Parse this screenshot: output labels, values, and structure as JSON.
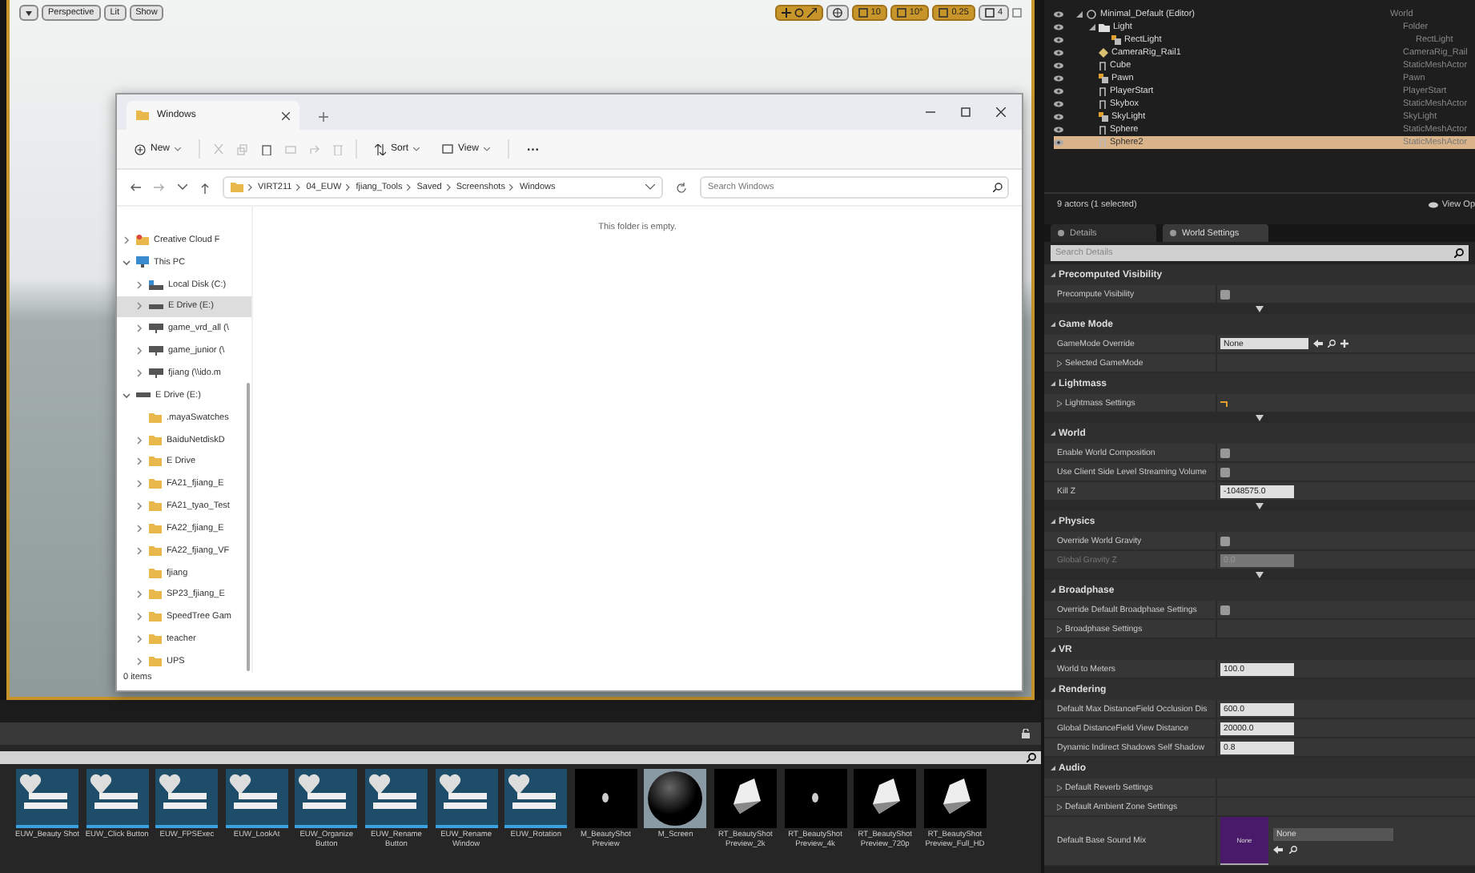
{
  "viewport": {
    "toolbar": {
      "left": [
        {
          "kind": "menu"
        },
        {
          "kind": "button",
          "label": "Perspective"
        },
        {
          "kind": "button",
          "label": "Lit"
        },
        {
          "kind": "button",
          "label": "Show"
        }
      ],
      "snap": [
        {
          "label": "10",
          "on": true
        },
        {
          "label": "10°",
          "on": true
        },
        {
          "label": "0.25",
          "on": true
        },
        {
          "label": "4",
          "on": false
        }
      ]
    }
  },
  "explorer": {
    "tab": "Windows",
    "toolbar": {
      "new": "New",
      "sort": "Sort",
      "view": "View",
      "more": "···"
    },
    "path": [
      "VIRT211",
      "04_EUW",
      "fjiang_Tools",
      "Saved",
      "Screenshots",
      "Windows"
    ],
    "search": {
      "placeholder": "Search Windows"
    },
    "empty_message": "This folder is empty.",
    "status": "0 items",
    "nav": [
      {
        "label": "Creative Cloud F",
        "kind": "cloud",
        "expanded": false,
        "selected": false
      },
      {
        "label": "This PC",
        "kind": "pc",
        "expanded": true,
        "selected": false,
        "children": [
          {
            "label": "Local Disk (C:)",
            "kind": "disk",
            "expanded": false,
            "selected": false
          },
          {
            "label": "E Drive (E:)",
            "kind": "drive",
            "expanded": false,
            "selected": true
          },
          {
            "label": "game_vrd_all (\\",
            "kind": "net",
            "expanded": false,
            "selected": false
          },
          {
            "label": "game_junior (\\",
            "kind": "net",
            "expanded": false,
            "selected": false
          },
          {
            "label": "fjiang (\\\\ido.m",
            "kind": "net",
            "expanded": false,
            "selected": false
          }
        ]
      },
      {
        "label": "E Drive (E:)",
        "kind": "drive",
        "expanded": true,
        "selected": false,
        "children": [
          {
            "label": ".mayaSwatches",
            "kind": "folder",
            "selected": false
          },
          {
            "label": "BaiduNetdiskD",
            "kind": "folder",
            "expanded": false,
            "selected": false
          },
          {
            "label": "E Drive",
            "kind": "folder",
            "expanded": false,
            "selected": false
          },
          {
            "label": "FA21_fjiang_E",
            "kind": "folder",
            "expanded": false,
            "selected": false
          },
          {
            "label": "FA21_tyao_Test",
            "kind": "folder",
            "expanded": false,
            "selected": false
          },
          {
            "label": "FA22_fjiang_E",
            "kind": "folder",
            "expanded": false,
            "selected": false
          },
          {
            "label": "FA22_fjiang_VF",
            "kind": "folder",
            "expanded": false,
            "selected": false
          },
          {
            "label": "fjiang",
            "kind": "folder",
            "selected": false
          },
          {
            "label": "SP23_fjiang_E",
            "kind": "folder",
            "expanded": false,
            "selected": false
          },
          {
            "label": "SpeedTree Gam",
            "kind": "folder",
            "expanded": false,
            "selected": false
          },
          {
            "label": "teacher",
            "kind": "folder",
            "expanded": false,
            "selected": false
          },
          {
            "label": "UPS",
            "kind": "folder",
            "expanded": false,
            "selected": false
          }
        ]
      }
    ]
  },
  "content_browser": {
    "assets": [
      {
        "name": "EUW_Beauty Shot",
        "kind": "widget"
      },
      {
        "name": "EUW_Click Button",
        "kind": "widget"
      },
      {
        "name": "EUW_FPSExec",
        "kind": "widget"
      },
      {
        "name": "EUW_LookAt",
        "kind": "widget"
      },
      {
        "name": "EUW_Organize Button",
        "kind": "widget"
      },
      {
        "name": "EUW_Rename Button",
        "kind": "widget"
      },
      {
        "name": "EUW_Rename Window",
        "kind": "widget"
      },
      {
        "name": "EUW_Rotation",
        "kind": "widget"
      },
      {
        "name": "M_BeautyShot Preview",
        "kind": "dot"
      },
      {
        "name": "M_Screen",
        "kind": "sphere"
      },
      {
        "name": "RT_BeautyShot Preview_2k",
        "kind": "card"
      },
      {
        "name": "RT_BeautyShot Preview_4k",
        "kind": "dot"
      },
      {
        "name": "RT_BeautyShot Preview_720p",
        "kind": "card"
      },
      {
        "name": "RT_BeautyShot Preview_Full_HD",
        "kind": "card"
      }
    ]
  },
  "outliner": {
    "rows": [
      {
        "name": "Minimal_Default (Editor)",
        "type": "World",
        "kind": "world",
        "expanded": true,
        "selected": false,
        "children": [
          {
            "name": "Light",
            "type": "Folder",
            "kind": "folder",
            "expanded": true,
            "selected": false,
            "children": [
              {
                "name": "RectLight",
                "type": "RectLight",
                "kind": "light",
                "selected": false
              }
            ]
          },
          {
            "name": "CameraRig_Rail1",
            "type": "CameraRig_Rail",
            "kind": "camera",
            "selected": false
          },
          {
            "name": "Cube",
            "type": "StaticMeshActor",
            "kind": "mesh",
            "selected": false
          },
          {
            "name": "Pawn",
            "type": "Pawn",
            "kind": "light",
            "selected": false
          },
          {
            "name": "PlayerStart",
            "type": "PlayerStart",
            "kind": "mesh",
            "selected": false
          },
          {
            "name": "Skybox",
            "type": "StaticMeshActor",
            "kind": "mesh",
            "selected": false
          },
          {
            "name": "SkyLight",
            "type": "SkyLight",
            "kind": "light",
            "selected": false
          },
          {
            "name": "Sphere",
            "type": "StaticMeshActor",
            "kind": "mesh",
            "selected": false
          },
          {
            "name": "Sphere2",
            "type": "StaticMeshActor",
            "kind": "mesh",
            "selected": true
          }
        ]
      }
    ],
    "footer": "9 actors (1 selected)",
    "view_options": "View Op"
  },
  "details": {
    "tabs": [
      {
        "label": "Details",
        "selected": false
      },
      {
        "label": "World Settings",
        "selected": true
      }
    ],
    "search": {
      "placeholder": "Search Details"
    },
    "sections": [
      {
        "title": "Precomputed Visibility",
        "advanced": true,
        "rows": [
          {
            "kind": "checkbox",
            "label": "Precompute Visibility",
            "checked": false
          }
        ]
      },
      {
        "title": "Game Mode",
        "advanced": false,
        "rows": [
          {
            "kind": "dropdown",
            "label": "GameMode Override",
            "value": "None"
          },
          {
            "kind": "expander",
            "label": "Selected GameMode"
          }
        ]
      },
      {
        "title": "Lightmass",
        "advanced": true,
        "rows": [
          {
            "kind": "struct",
            "label": "Lightmass Settings"
          }
        ]
      },
      {
        "title": "World",
        "advanced": true,
        "rows": [
          {
            "kind": "checkbox",
            "label": "Enable World Composition",
            "checked": false
          },
          {
            "kind": "checkbox",
            "label": "Use Client Side Level Streaming Volume",
            "checked": false
          },
          {
            "kind": "number",
            "label": "Kill Z",
            "value": "-1048575.0",
            "disabled": false
          }
        ]
      },
      {
        "title": "Physics",
        "advanced": true,
        "rows": [
          {
            "kind": "checkbox",
            "label": "Override World Gravity",
            "checked": false
          },
          {
            "kind": "number",
            "label": "Global Gravity Z",
            "value": "0.0",
            "disabled": true
          }
        ]
      },
      {
        "title": "Broadphase",
        "advanced": false,
        "rows": [
          {
            "kind": "checkbox",
            "label": "Override Default Broadphase Settings",
            "checked": false
          },
          {
            "kind": "expander",
            "label": "Broadphase Settings"
          }
        ]
      },
      {
        "title": "VR",
        "advanced": false,
        "rows": [
          {
            "kind": "number",
            "label": "World to Meters",
            "value": "100.0",
            "disabled": false
          }
        ]
      },
      {
        "title": "Rendering",
        "advanced": false,
        "rows": [
          {
            "kind": "number",
            "label": "Default Max DistanceField Occlusion Dis",
            "value": "600.0",
            "disabled": false
          },
          {
            "kind": "number",
            "label": "Global DistanceField View Distance",
            "value": "20000.0",
            "disabled": false
          },
          {
            "kind": "number",
            "label": "Dynamic Indirect Shadows Self Shadow",
            "value": "0.8",
            "disabled": false
          }
        ]
      },
      {
        "title": "Audio",
        "advanced": false,
        "rows": [
          {
            "kind": "expander",
            "label": "Default Reverb Settings"
          },
          {
            "kind": "expander",
            "label": "Default Ambient Zone Settings"
          },
          {
            "kind": "sound",
            "label": "Default Base Sound Mix",
            "thumb": "None",
            "value": "None"
          }
        ]
      }
    ]
  }
}
